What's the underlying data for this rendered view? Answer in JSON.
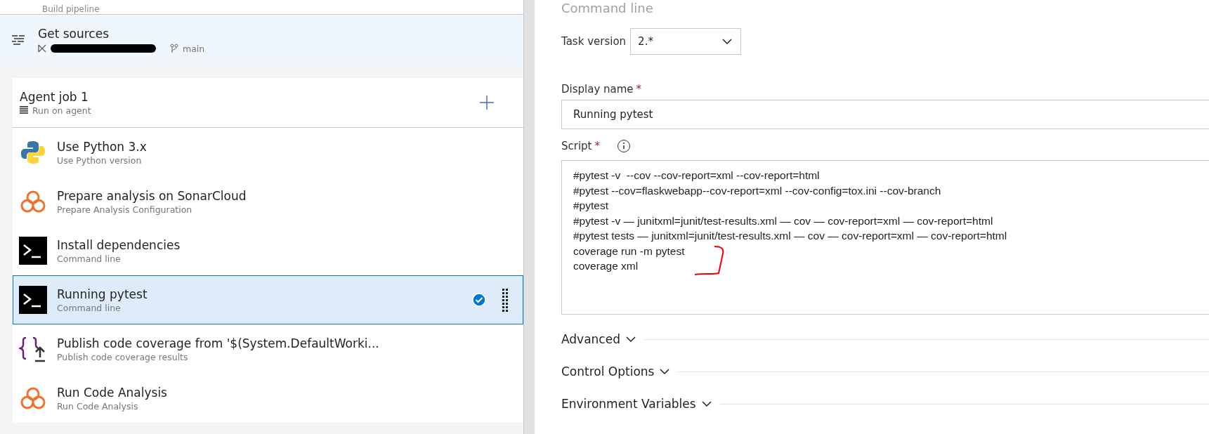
{
  "pipeline": {
    "subtitle": "Build pipeline"
  },
  "get_sources": {
    "title": "Get sources",
    "branch": "main"
  },
  "agent_job": {
    "title": "Agent job 1",
    "subtitle": "Run on agent"
  },
  "tasks": [
    {
      "kind": "python",
      "title": "Use Python 3.x",
      "subtitle": "Use Python version",
      "selected": false
    },
    {
      "kind": "sonar",
      "title": "Prepare analysis on SonarCloud",
      "subtitle": "Prepare Analysis Configuration",
      "selected": false
    },
    {
      "kind": "terminal",
      "title": "Install dependencies",
      "subtitle": "Command line",
      "selected": false
    },
    {
      "kind": "terminal",
      "title": "Running pytest",
      "subtitle": "Command line",
      "selected": true
    },
    {
      "kind": "publish",
      "title": "Publish code coverage from '$(System.DefaultWorki...",
      "subtitle": "Publish code coverage results",
      "selected": false
    },
    {
      "kind": "sonar",
      "title": "Run Code Analysis",
      "subtitle": "Run Code Analysis",
      "selected": false
    }
  ],
  "task_panel": {
    "title": "Command line",
    "task_version": {
      "label": "Task version",
      "value": "2.*"
    },
    "display_name": {
      "label": "Display name",
      "required_mark": "*",
      "value": "Running pytest"
    },
    "script": {
      "label": "Script",
      "required_mark": "*",
      "lines": [
        "#pytest -v  --cov --cov-report=xml --cov-report=html",
        "#pytest --cov=flaskwebapp--cov-report=xml --cov-config=tox.ini --cov-branch",
        "#pytest",
        "#pytest -v — junitxml=junit/test-results.xml — cov — cov-report=xml — cov-report=html",
        "#pytest tests — junitxml=junit/test-results.xml — cov — cov-report=xml — cov-report=html",
        "coverage run -m pytest",
        "coverage xml"
      ]
    },
    "sections": [
      {
        "label": "Advanced",
        "expanded": false
      },
      {
        "label": "Control Options",
        "expanded": false
      },
      {
        "label": "Environment Variables",
        "expanded": false
      }
    ]
  }
}
